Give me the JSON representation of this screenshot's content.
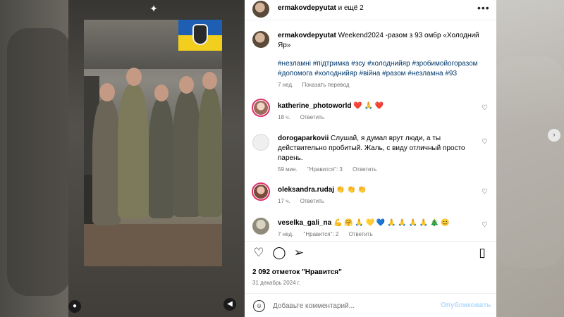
{
  "header": {
    "username": "ermakovdepyutat",
    "suffix": "и ещё 2",
    "more_glyph": "•••"
  },
  "caption": {
    "username": "ermakovdepyutat",
    "text": "Weekend2024 -разом з 93 омбр «Холодний Яр»",
    "hashtags": "#незламні #підтримка #зсу #холоднийяр #зробимойогоразом #допомога #холоднийяр #війна #разом #незламна #93",
    "time": "7 нед.",
    "translate": "Показать перевод"
  },
  "comments": [
    {
      "username": "katherine_photoworld",
      "text": "❤️ 🙏 ❤️",
      "time": "18 ч.",
      "likes": "",
      "reply": "Ответить"
    },
    {
      "username": "dorogaparkovii",
      "text": "Слушай, я думал врут люди, а ты действительно пробитый. Жаль, с виду отличный просто парень.",
      "time": "59 мин.",
      "likes": "\"Нравится\": 3",
      "reply": "Ответить"
    },
    {
      "username": "oleksandra.rudaj",
      "text": "👏 👏 👏",
      "time": "17 ч.",
      "likes": "",
      "reply": "Ответить"
    },
    {
      "username": "veselka_gali_na",
      "text": "💪 🤗 🙏 💛 💙 🙏 🙏 🙏 🙏 🎄 😊",
      "time": "7 нед.",
      "likes": "\"Нравится\": 2",
      "reply": "Ответить"
    }
  ],
  "engagement": {
    "likes": "2 092 отметок \"Нравится\"",
    "date": "31 декабрь 2024 г."
  },
  "composer": {
    "placeholder": "Добавьте комментарий...",
    "post_label": "Опубликовать"
  },
  "icons": {
    "sparkle": "sparkle-icon",
    "user": "user-icon",
    "mute": "volume-off-icon",
    "like": "heart-icon",
    "comment": "comment-icon",
    "share": "share-icon",
    "save": "bookmark-icon",
    "emoji": "emoji-icon",
    "next": "chevron-right-icon"
  },
  "colors": {
    "hashtag": "#00376b",
    "muted": "#737373",
    "post_button": "#b3dbff",
    "flag_blue": "#1f5fb3",
    "flag_yellow": "#f2cf1d"
  }
}
